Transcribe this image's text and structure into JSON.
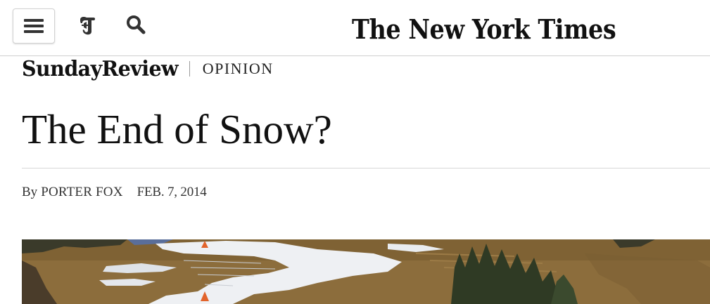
{
  "header": {
    "menu_icon": "hamburger-menu-icon",
    "t_logo_icon": "nyt-t-logo-icon",
    "search_icon": "search-icon",
    "wordmark": "The New York Times"
  },
  "section": {
    "name": "SundayReview",
    "kicker": "OPINION"
  },
  "article": {
    "headline": "The End of Snow?",
    "byline_prefix": "By",
    "author": "PORTER FOX",
    "date": "FEB. 7, 2014",
    "lead_image": "photo-patchy-snow-on-brown-hillside"
  },
  "colors": {
    "text": "#111111",
    "rule": "#d6d6d6",
    "grass": "#8a6a3b",
    "snow": "#eef0f3",
    "trees": "#2f3a24",
    "cone": "#e2632b"
  }
}
